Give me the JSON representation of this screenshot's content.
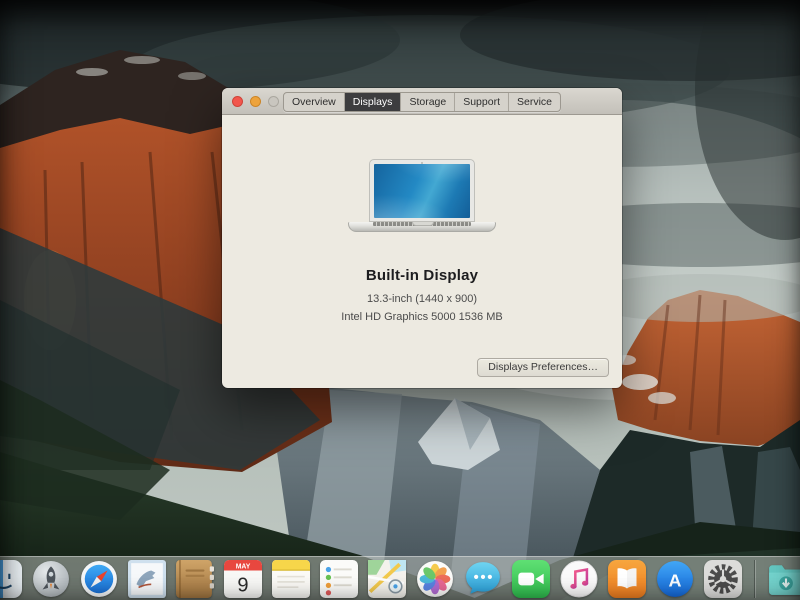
{
  "window": {
    "tabs": [
      {
        "label": "Overview",
        "selected": false
      },
      {
        "label": "Displays",
        "selected": true
      },
      {
        "label": "Storage",
        "selected": false
      },
      {
        "label": "Support",
        "selected": false
      },
      {
        "label": "Service",
        "selected": false
      }
    ],
    "traffic_lights": [
      "close",
      "minimize",
      "zoom-disabled"
    ],
    "display": {
      "title": "Built-in Display",
      "size_resolution": "13.3-inch (1440 x 900)",
      "graphics": "Intel HD Graphics 5000 1536 MB"
    },
    "preferences_button": "Displays Preferences…",
    "laptop_image": "macbook-air-front-view"
  },
  "dock": {
    "items": [
      {
        "id": "finder",
        "name": "Finder"
      },
      {
        "id": "launchpad",
        "name": "Launchpad"
      },
      {
        "id": "safari",
        "name": "Safari"
      },
      {
        "id": "mail",
        "name": "Mail"
      },
      {
        "id": "contacts",
        "name": "Contacts"
      },
      {
        "id": "calendar",
        "name": "Calendar"
      },
      {
        "id": "notes",
        "name": "Notes"
      },
      {
        "id": "reminders",
        "name": "Reminders"
      },
      {
        "id": "maps",
        "name": "Maps"
      },
      {
        "id": "photos",
        "name": "Photos"
      },
      {
        "id": "messages",
        "name": "Messages"
      },
      {
        "id": "facetime",
        "name": "FaceTime"
      },
      {
        "id": "itunes",
        "name": "iTunes"
      },
      {
        "id": "ibooks",
        "name": "iBooks"
      },
      {
        "id": "appstore",
        "name": "App Store"
      },
      {
        "id": "prefs",
        "name": "System Preferences"
      },
      {
        "id": "separator",
        "name": "Separator"
      },
      {
        "id": "downloads",
        "name": "Downloads"
      }
    ],
    "calendar": {
      "month": "MAY",
      "day": "9"
    }
  },
  "colors": {
    "window_bg": "#edeae1",
    "titlebar_top": "#dad7d0",
    "titlebar_bottom": "#c3c0b9",
    "tab_selected": "#3d3d3f",
    "traffic_close": "#f2564d",
    "traffic_minimize": "#eda33c",
    "traffic_zoom_disabled": "#c9c6bf",
    "dock_bg": "rgba(186,192,186,0.55)"
  },
  "wallpaper": {
    "name": "OS X El Capitan (Yosemite valley at dusk)"
  }
}
